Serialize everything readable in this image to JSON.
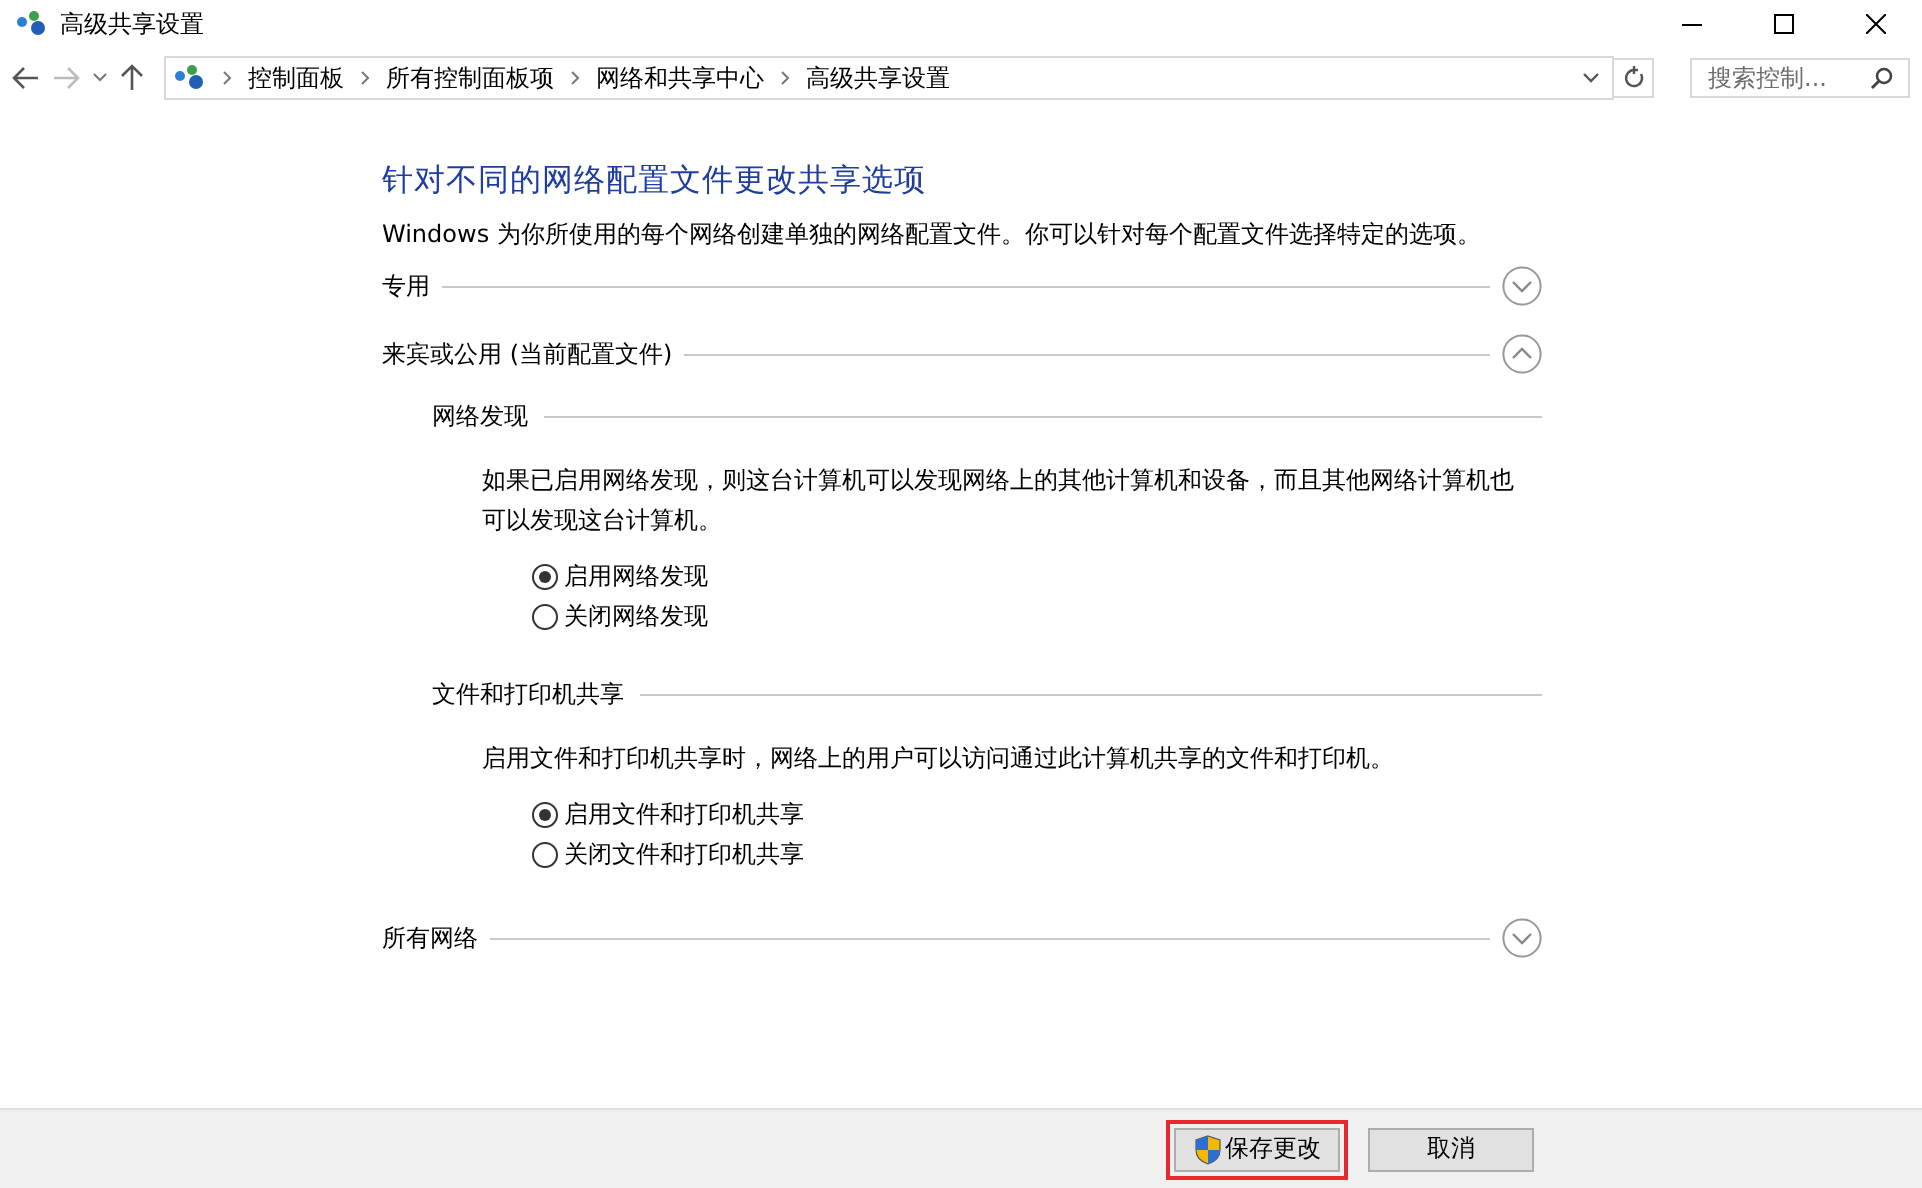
{
  "window": {
    "title": "高级共享设置"
  },
  "address_bar": {
    "breadcrumbs": [
      "控制面板",
      "所有控制面板项",
      "网络和共享中心",
      "高级共享设置"
    ]
  },
  "search": {
    "placeholder": "搜索控制..."
  },
  "heading": "针对不同的网络配置文件更改共享选项",
  "intro": "Windows 为你所使用的每个网络创建单独的网络配置文件。你可以针对每个配置文件选择特定的选项。",
  "profiles": [
    {
      "label": "专用",
      "expanded": false
    },
    {
      "label": "来宾或公用 (当前配置文件)",
      "expanded": true,
      "sections": [
        {
          "title": "网络发现",
          "description": "如果已启用网络发现，则这台计算机可以发现网络上的其他计算机和设备，而且其他网络计算机也可以发现这台计算机。",
          "options": [
            {
              "label": "启用网络发现",
              "selected": true
            },
            {
              "label": "关闭网络发现",
              "selected": false
            }
          ]
        },
        {
          "title": "文件和打印机共享",
          "description": "启用文件和打印机共享时，网络上的用户可以访问通过此计算机共享的文件和打印机。",
          "options": [
            {
              "label": "启用文件和打印机共享",
              "selected": true
            },
            {
              "label": "关闭文件和打印机共享",
              "selected": false
            }
          ]
        }
      ]
    },
    {
      "label": "所有网络",
      "expanded": false
    }
  ],
  "buttons": [
    {
      "label": "保存更改",
      "kind": "shield",
      "highlighted": true
    },
    {
      "label": "取消",
      "kind": "plain",
      "highlighted": false
    }
  ]
}
